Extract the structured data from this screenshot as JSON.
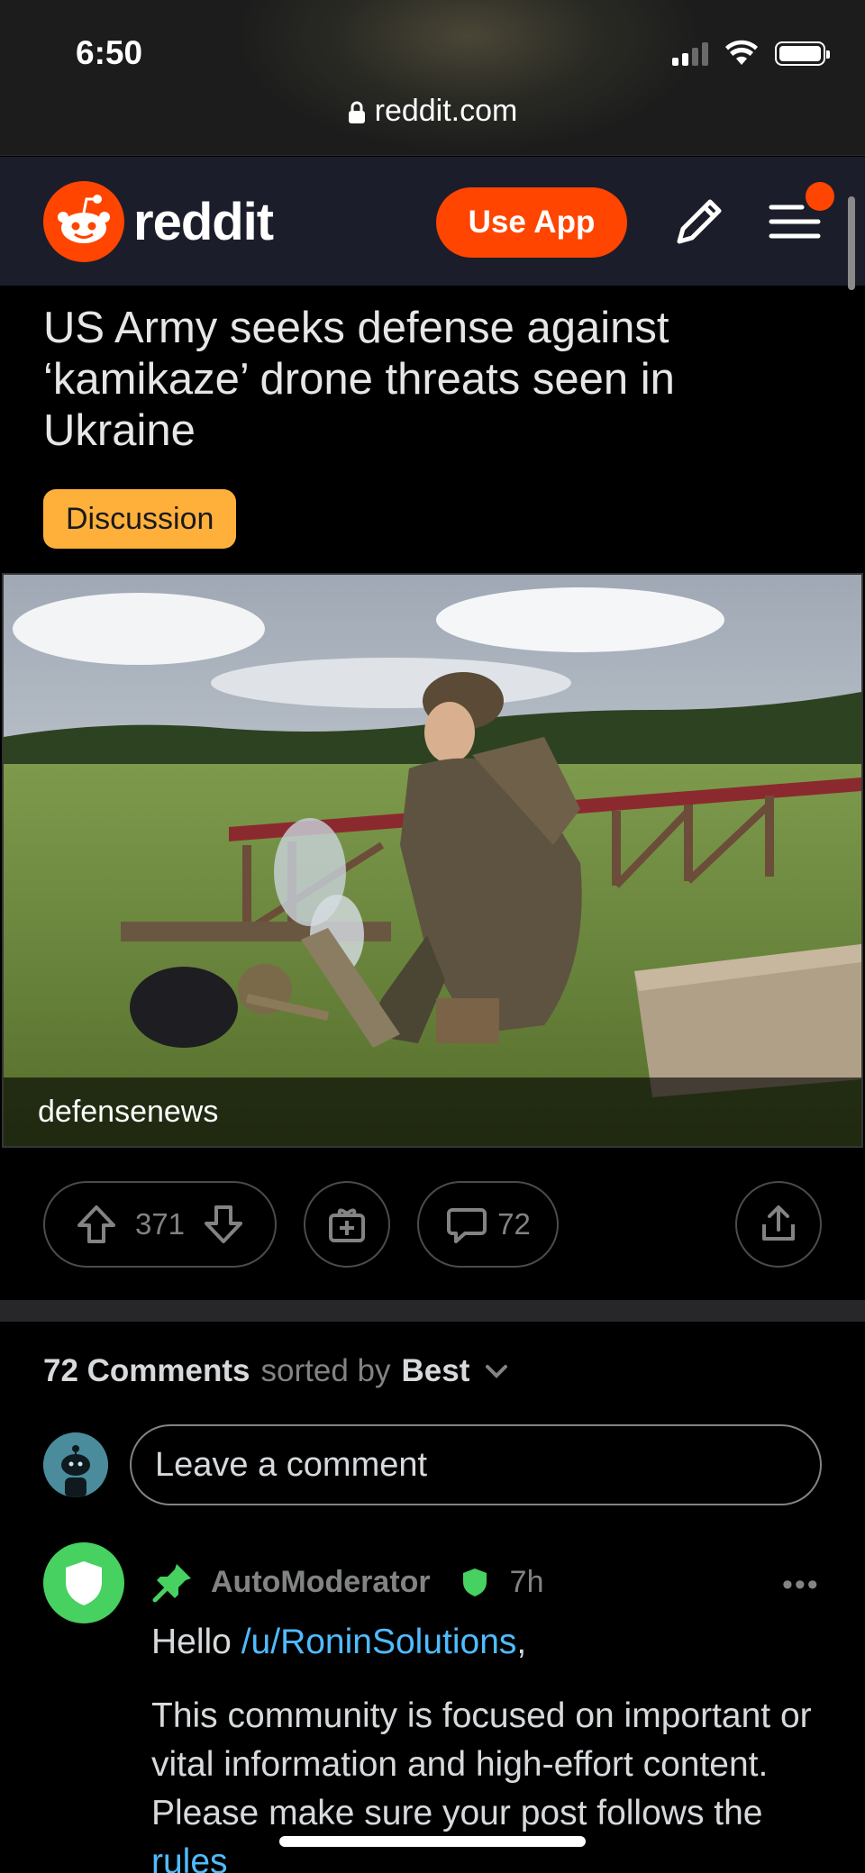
{
  "status_bar": {
    "time": "6:50"
  },
  "browser": {
    "url": "reddit.com"
  },
  "header": {
    "brand": "reddit",
    "use_app_label": "Use App"
  },
  "post": {
    "title": "US Army seeks defense against ‘kamikaze’ drone threats seen in Ukraine",
    "flair": "Discussion",
    "media_source": "defensenews",
    "vote_count": "371",
    "comment_count": "72"
  },
  "comments": {
    "count_label": "72 Comments",
    "sorted_by_label": "sorted by",
    "sort_value": "Best",
    "input_placeholder": "Leave a comment",
    "items": [
      {
        "author": "AutoModerator",
        "time": "7h",
        "greeting_prefix": "Hello ",
        "greeting_link": "/u/RoninSolutions",
        "greeting_suffix": ",",
        "body_text": "This community is focused on important or vital information and high-effort content. Please make sure your post follows the ",
        "body_link": "rules"
      }
    ]
  },
  "colors": {
    "brand": "#ff4500",
    "flair": "#ffb03b",
    "mod_green": "#46d160",
    "link": "#4fbcff"
  },
  "icons": [
    "lock-icon",
    "signal-icon",
    "wifi-icon",
    "battery-icon",
    "snoo-icon",
    "pencil-icon",
    "menu-icon",
    "upvote-icon",
    "downvote-icon",
    "award-icon",
    "comment-icon",
    "share-icon",
    "chevron-down-icon",
    "pin-icon",
    "shield-icon",
    "more-icon"
  ]
}
